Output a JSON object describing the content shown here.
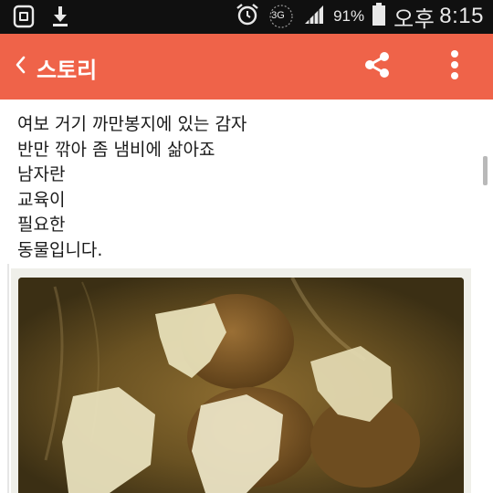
{
  "status_bar": {
    "battery_percent": "91%",
    "network": "3G",
    "ampm": "오후",
    "time": "8:15",
    "icons": [
      "sim-card-icon",
      "download-icon",
      "alarm-icon",
      "network-3g-icon",
      "signal-icon",
      "battery-icon"
    ]
  },
  "app_bar": {
    "title": "스토리",
    "color": "#ef6349",
    "icons": [
      "back-chevron-icon",
      "share-icon",
      "more-vert-icon"
    ]
  },
  "post": {
    "lines": [
      "여보 거기 까만봉지에 있는 감자",
      "반만 깎아 좀 냄비에 삶아죠",
      "남자란",
      "교육이",
      "필요한",
      "동물입니다."
    ]
  },
  "photo": {
    "icon": "boiled-potatoes-photo"
  }
}
